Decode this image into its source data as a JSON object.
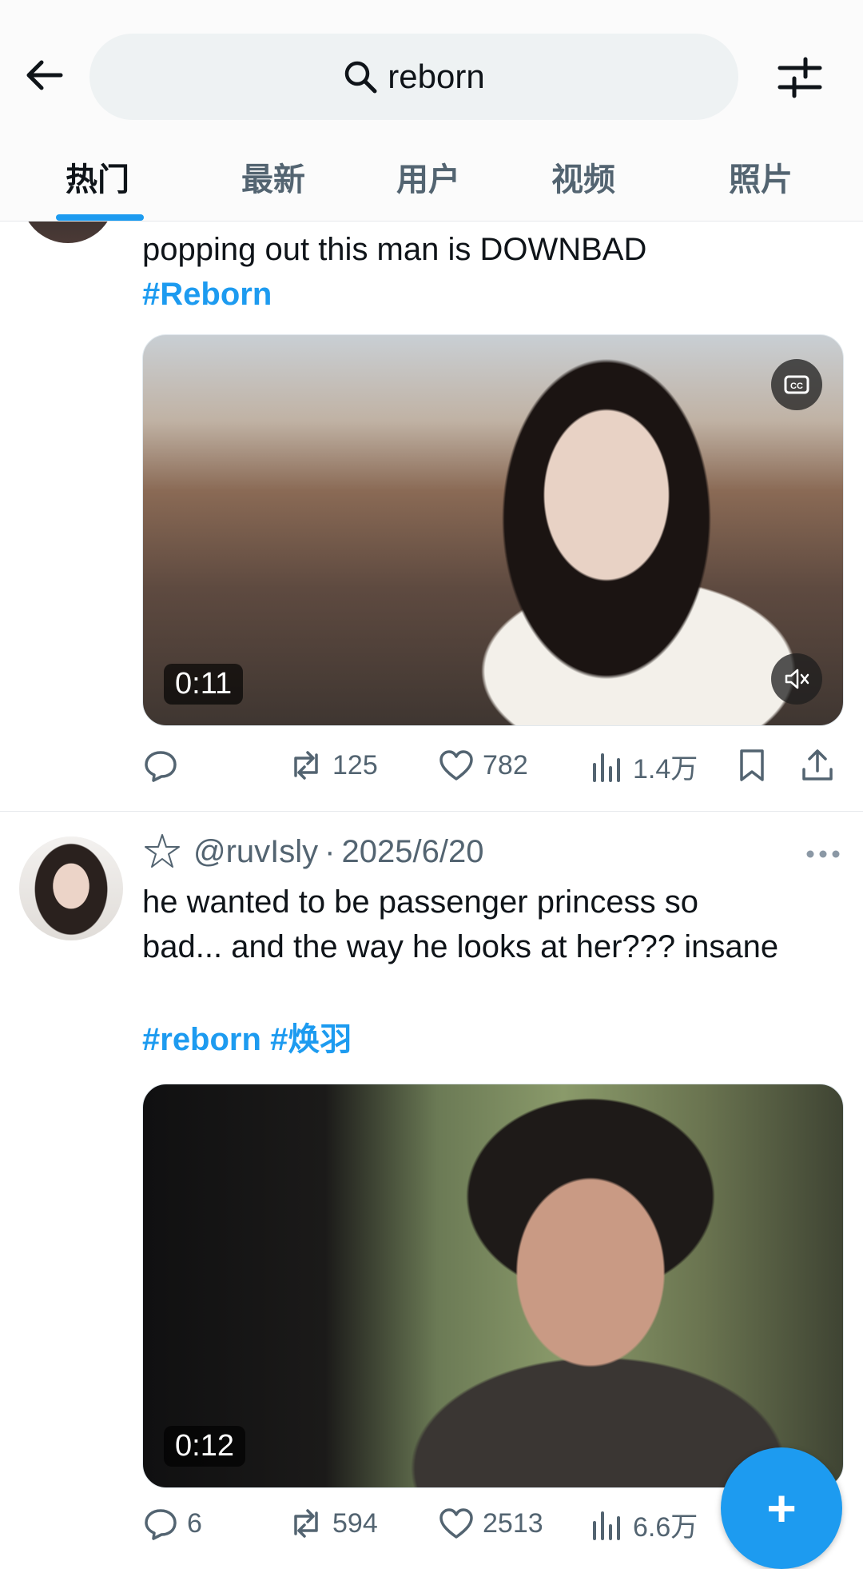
{
  "header": {
    "search_query": "reborn",
    "tabs": [
      {
        "label": "热门",
        "active": true
      },
      {
        "label": "最新"
      },
      {
        "label": "用户"
      },
      {
        "label": "视频"
      },
      {
        "label": "照片"
      }
    ]
  },
  "post1": {
    "text_line": "popping out this man is DOWNBAD",
    "hashtag": "#Reborn",
    "video_duration": "0:11",
    "stats": {
      "reply": "",
      "retweet": "125",
      "like": "782",
      "views": "1.4万"
    }
  },
  "post2": {
    "handle": "@ruvIsly",
    "date_sep": "·",
    "date": "2025/6/20",
    "text_line1": "he wanted to be passenger princess so",
    "text_line2": "bad... and the way he looks at her??? insane",
    "hashtag1": "#reborn",
    "hashtag2": "#焕羽",
    "video_duration": "0:12",
    "stats": {
      "reply": "6",
      "retweet": "594",
      "like": "2513",
      "views": "6.6万"
    }
  },
  "fab": {
    "label": "+"
  },
  "icons": {
    "back": "arrow-left-icon",
    "search": "search-icon",
    "filter": "sliders-icon",
    "captions": "captions-icon",
    "mute": "mute-icon",
    "reply": "reply-icon",
    "retweet": "retweet-icon",
    "like": "heart-icon",
    "views": "views-icon",
    "bookmark": "bookmark-icon",
    "share": "share-icon"
  },
  "colors": {
    "accent": "#1d9bf0",
    "text": "#0f1419",
    "muted": "#536471"
  }
}
